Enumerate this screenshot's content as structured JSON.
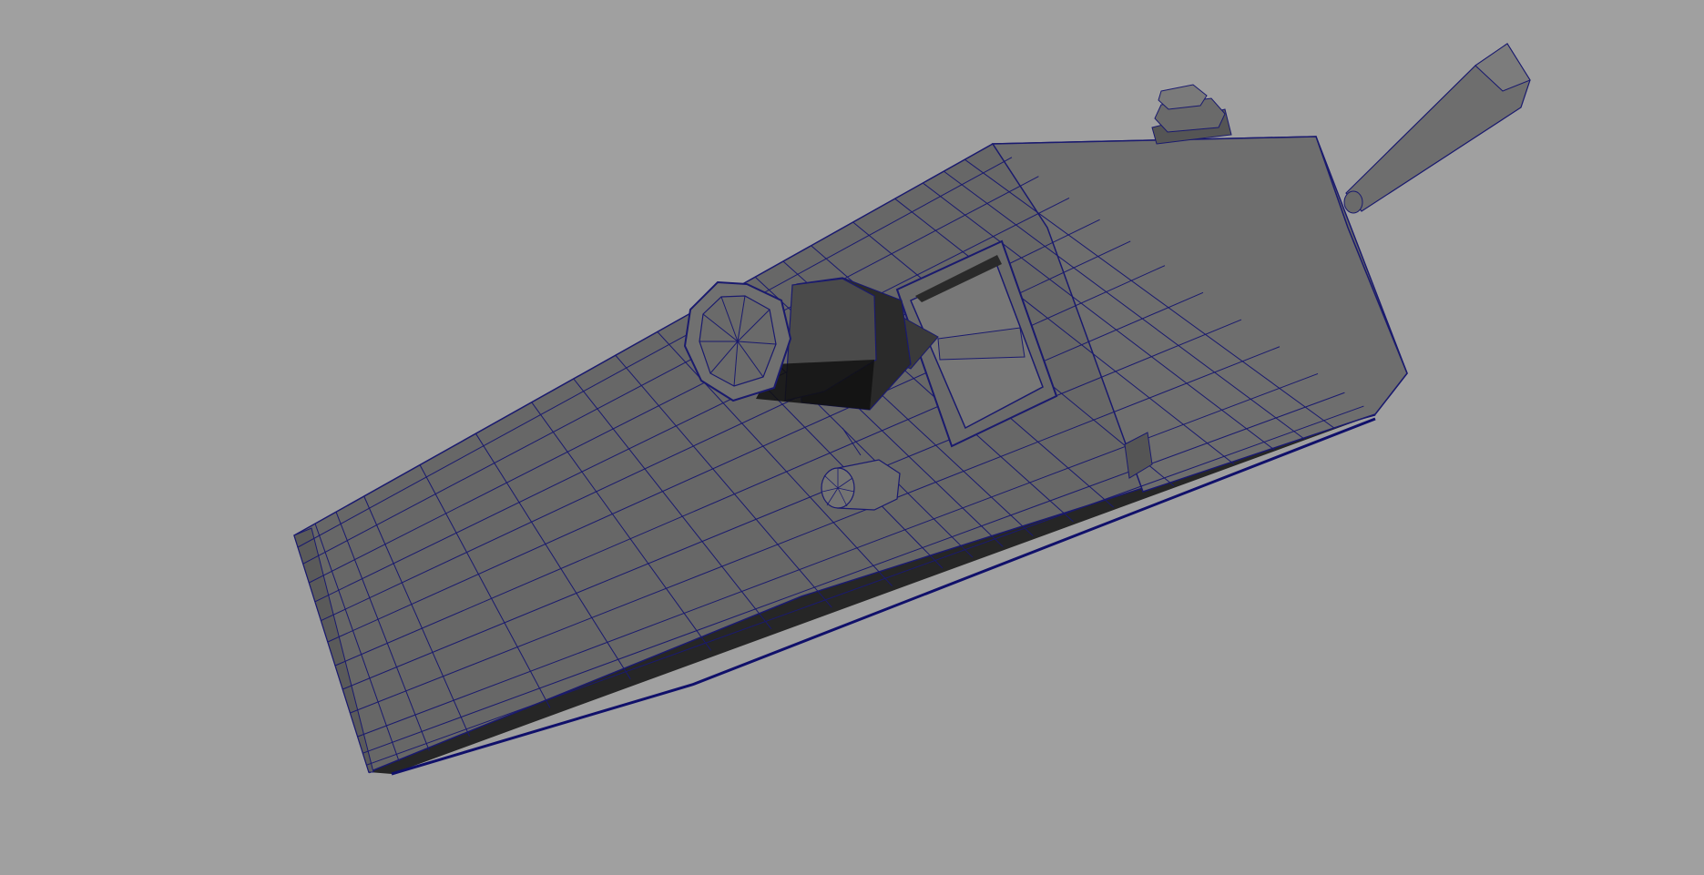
{
  "viewport": {
    "background_color": "#a0a0a0",
    "wireframe_color": "#1a1a6e",
    "shading": "smooth-shade-with-wireframe"
  },
  "model": {
    "description_icon": "walkie-talkie-mesh",
    "colors": {
      "top_face": "#6a6a6a",
      "front_face": "#5f5f5f",
      "end_face": "#707070",
      "underside": "#262626",
      "underside_rim": "#10106a",
      "knob_dark": "#2b2b2b",
      "knob_mid": "#4a4a4a",
      "antenna": "#6e6e6e"
    }
  }
}
